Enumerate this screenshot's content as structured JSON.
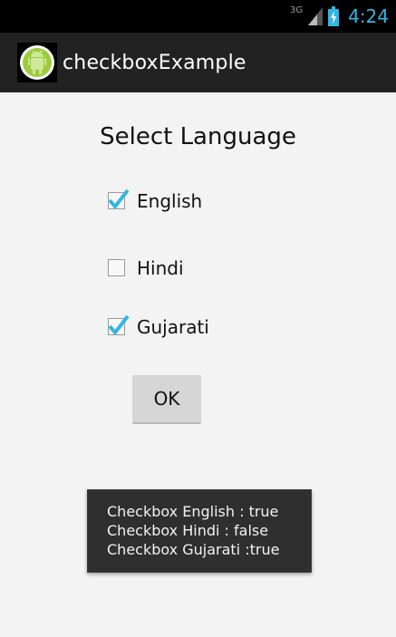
{
  "status_bar": {
    "network": "3G",
    "time": "4:24",
    "signal_icon": "signal-icon",
    "battery_icon": "battery-charging-icon",
    "accent_color": "#33b5e5"
  },
  "action_bar": {
    "title": "checkboxExample",
    "icon": "android-app-icon"
  },
  "content": {
    "heading": "Select Language",
    "checkboxes": [
      {
        "label": "English",
        "checked": true
      },
      {
        "label": "Hindi",
        "checked": false
      },
      {
        "label": "Gujarati",
        "checked": true
      }
    ],
    "ok_label": "OK"
  },
  "toast": {
    "lines": [
      "Checkbox English : true",
      "Checkbox Hindi : false",
      "Checkbox Gujarati :true"
    ]
  }
}
